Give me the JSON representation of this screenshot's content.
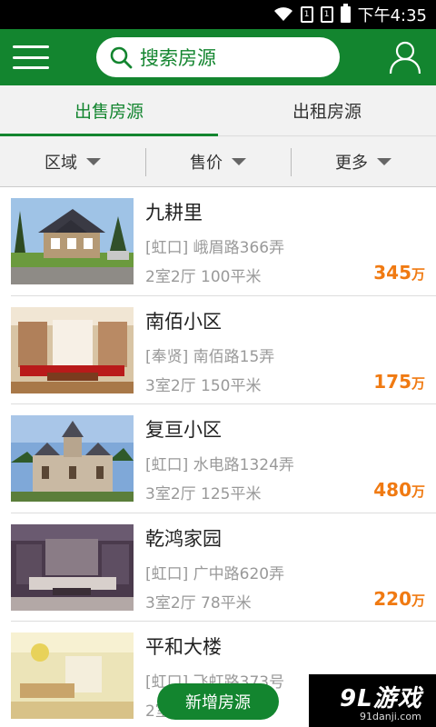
{
  "status_bar": {
    "time": "下午4:35",
    "sim1": "1",
    "sim2": "1"
  },
  "header": {
    "search_placeholder": "搜索房源"
  },
  "tabs": [
    {
      "label": "出售房源",
      "active": true
    },
    {
      "label": "出租房源",
      "active": false
    }
  ],
  "filters": [
    {
      "label": "区域"
    },
    {
      "label": "售价"
    },
    {
      "label": "更多"
    }
  ],
  "listings": [
    {
      "name": "九耕里",
      "address": "[虹口] 峨眉路366弄",
      "spec": "2室2厅 100平米",
      "price": "345",
      "unit": "万"
    },
    {
      "name": "南佰小区",
      "address": "[奉贤] 南佰路15弄",
      "spec": "3室2厅 150平米",
      "price": "175",
      "unit": "万"
    },
    {
      "name": "复亘小区",
      "address": "[虹口] 水电路1324弄",
      "spec": "3室2厅 125平米",
      "price": "480",
      "unit": "万"
    },
    {
      "name": "乾鸿家园",
      "address": "[虹口] 广中路620弄",
      "spec": "3室2厅 78平米",
      "price": "220",
      "unit": "万"
    },
    {
      "name": "平和大楼",
      "address": "[虹口] 飞虹路373号",
      "spec": "2室",
      "price": "",
      "unit": ""
    }
  ],
  "add_button": "新增房源",
  "watermark": {
    "main": "9L游戏",
    "sub": "91danji.com"
  },
  "colors": {
    "brand_green": "#13852f",
    "price_orange": "#f07a12"
  }
}
